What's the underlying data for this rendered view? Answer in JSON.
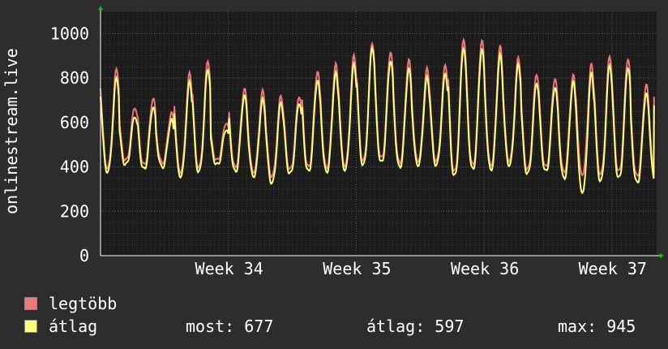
{
  "y_axis_label": "onlinestream.live",
  "legend": [
    {
      "label": "legtöbb",
      "color": "#f0767a"
    },
    {
      "label": "átlag",
      "color": "#ffff7a"
    }
  ],
  "stats": {
    "current_label": "most:",
    "current_value": "677",
    "average_label": "átlag:",
    "average_value": "597",
    "max_label": "max:",
    "max_value": "945"
  },
  "colors": {
    "background": "#2d2d2d",
    "plot_background": "#1b1b1b",
    "grid": "#5a5a5a",
    "text": "#ffffff",
    "arrow": "#00cc00",
    "max_series": "#f0767a",
    "avg_series": "#ffff7a"
  },
  "chart_data": {
    "type": "line",
    "ylim": [
      0,
      1100
    ],
    "yticks": [
      0,
      200,
      400,
      600,
      800,
      1000
    ],
    "x_range_weeks": [
      33.0,
      37.35
    ],
    "xticks": [
      {
        "value": 34,
        "label": "Week 34"
      },
      {
        "value": 35,
        "label": "Week 35"
      },
      {
        "value": 36,
        "label": "Week 36"
      },
      {
        "value": 37,
        "label": "Week 37"
      }
    ],
    "grid": true,
    "daily_series": {
      "max_low": [
        400,
        430,
        410,
        420,
        380,
        400,
        430,
        400,
        380,
        360,
        390,
        400,
        400,
        410,
        430,
        440,
        420,
        430,
        430,
        380,
        410,
        410,
        430,
        390,
        400,
        380,
        370,
        370,
        380,
        360
      ],
      "max_high": [
        840,
        670,
        710,
        640,
        820,
        880,
        600,
        750,
        740,
        720,
        720,
        830,
        860,
        900,
        960,
        920,
        880,
        840,
        860,
        980,
        970,
        940,
        890,
        820,
        800,
        810,
        860,
        900,
        890,
        770
      ],
      "avg_low": [
        380,
        410,
        390,
        400,
        360,
        380,
        410,
        380,
        360,
        330,
        370,
        380,
        380,
        390,
        410,
        420,
        400,
        410,
        410,
        360,
        390,
        390,
        410,
        370,
        380,
        350,
        290,
        340,
        350,
        330
      ],
      "avg_high": [
        800,
        630,
        670,
        610,
        780,
        840,
        570,
        720,
        700,
        690,
        690,
        790,
        820,
        860,
        940,
        880,
        840,
        800,
        820,
        940,
        930,
        900,
        860,
        780,
        760,
        780,
        820,
        860,
        850,
        730
      ],
      "current_avg_end": 677,
      "current_max_end": 715
    },
    "series": [
      {
        "name": "legtöbb",
        "color": "#f0767a"
      },
      {
        "name": "átlag",
        "color": "#ffff7a"
      }
    ]
  }
}
